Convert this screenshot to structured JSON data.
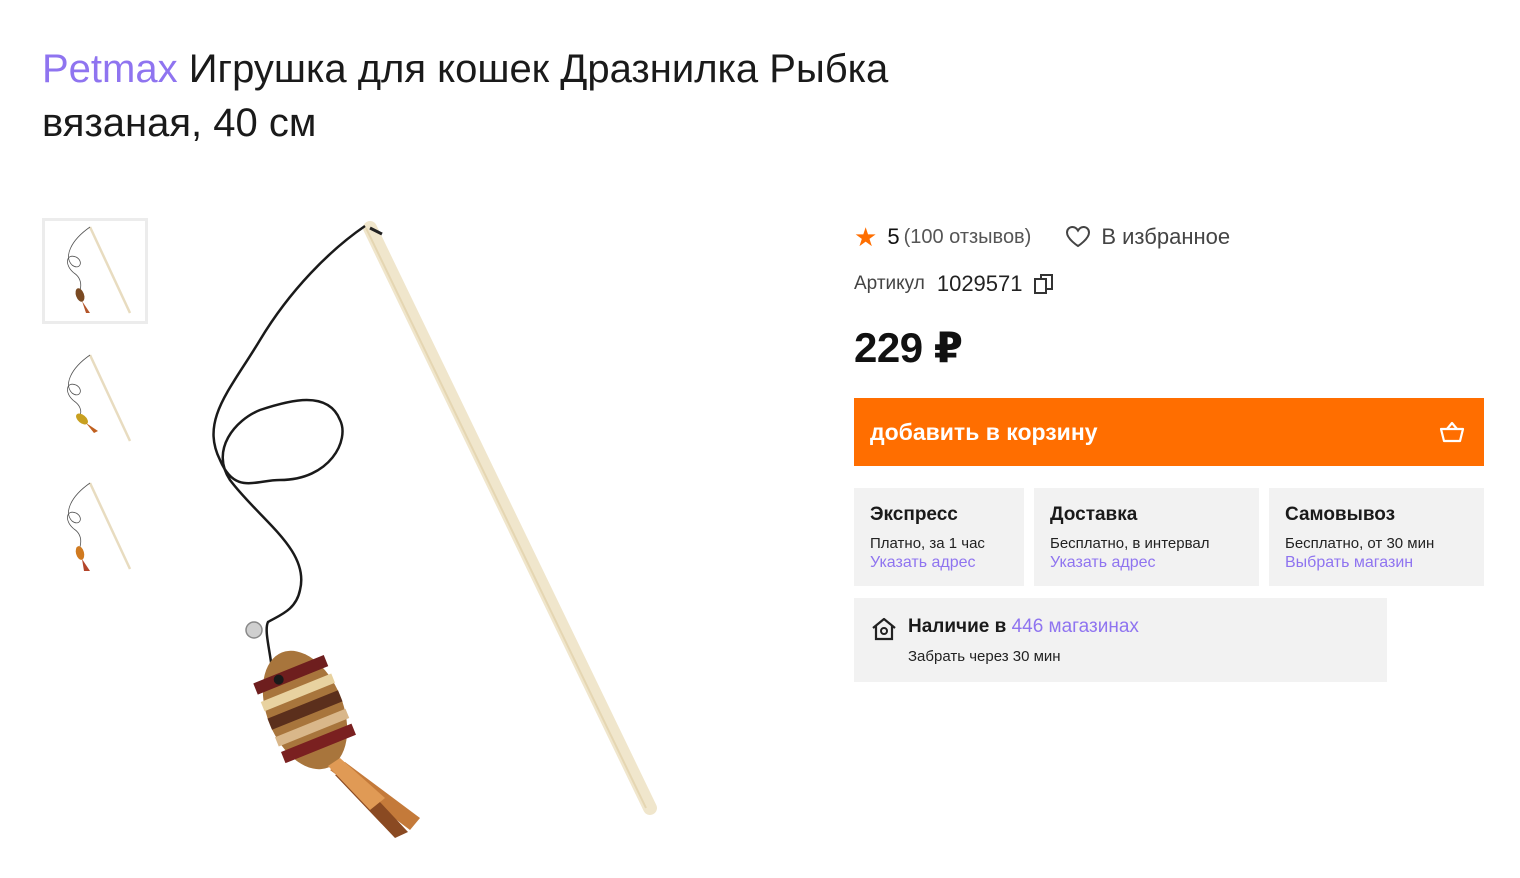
{
  "product": {
    "brand": "Petmax",
    "title": "Игрушка для кошек Дразнилка Рыбка вязаная, 40 см"
  },
  "thumbnails": [
    {
      "icon": "product-photo-brown-fish",
      "active": true
    },
    {
      "icon": "product-photo-yellow-fish",
      "active": false
    },
    {
      "icon": "product-photo-orange-fish",
      "active": false
    }
  ],
  "rating": {
    "value": "5",
    "reviews": "(100 отзывов)"
  },
  "favorite": {
    "label": "В избранное"
  },
  "sku": {
    "label": "Артикул",
    "value": "1029571"
  },
  "price": "229 ₽",
  "cart_button": {
    "label": "добавить в корзину"
  },
  "delivery": [
    {
      "title": "Экспресс",
      "subtitle": "Платно, за 1 час",
      "link": "Указать адрес"
    },
    {
      "title": "Доставка",
      "subtitle": "Бесплатно, в интервал",
      "link": "Указать адрес"
    },
    {
      "title": "Самовывоз",
      "subtitle": "Бесплатно, от 30 мин",
      "link": "Выбрать магазин"
    }
  ],
  "stock": {
    "prefix": "Наличие в",
    "link": "446 магазинах",
    "subtitle": "Забрать через 30 мин"
  },
  "colors": {
    "accent": "#ff6e00",
    "link": "#8f74f0",
    "card_bg": "#f2f2f2"
  }
}
